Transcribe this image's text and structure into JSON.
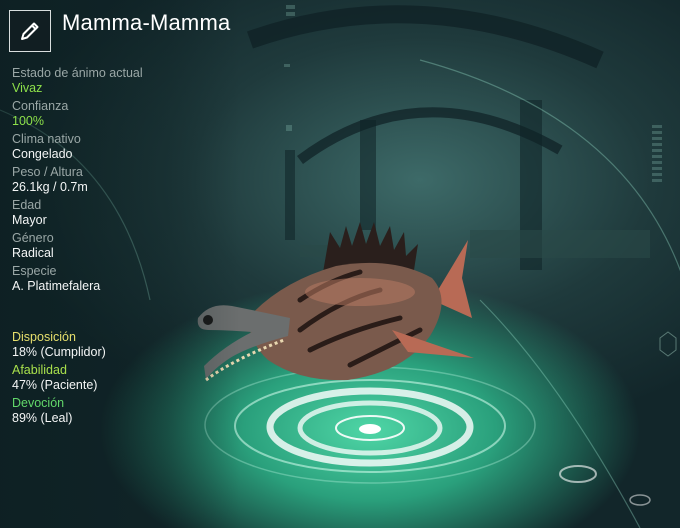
{
  "creature": {
    "name": "Mamma-Mamma"
  },
  "stats": {
    "mood": {
      "label": "Estado de ánimo actual",
      "value": "Vivaz"
    },
    "trust": {
      "label": "Confianza",
      "value": "100%"
    },
    "climate": {
      "label": "Clima nativo",
      "value": "Congelado"
    },
    "size": {
      "label": "Peso / Altura",
      "value": "26.1kg / 0.7m"
    },
    "age": {
      "label": "Edad",
      "value": "Mayor"
    },
    "gender": {
      "label": "Género",
      "value": "Radical"
    },
    "species": {
      "label": "Especie",
      "value": "A. Platimefalera"
    }
  },
  "traits": {
    "disposition": {
      "label": "Disposición",
      "value": "18% (Cumplidor)"
    },
    "affinity": {
      "label": "Afabilidad",
      "value": "47% (Paciente)"
    },
    "devotion": {
      "label": "Devoción",
      "value": "89% (Leal)"
    }
  },
  "icons": {
    "edit": "pencil-icon"
  },
  "colors": {
    "positive": "#8de04a",
    "disposition": "#e6df6c",
    "affinity": "#a8e04c",
    "devotion": "#62d86a"
  }
}
